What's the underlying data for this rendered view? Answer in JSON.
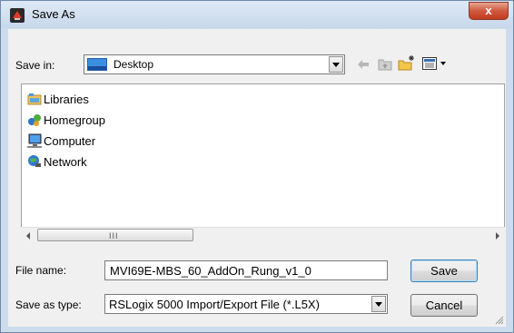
{
  "window": {
    "title": "Save As",
    "close_label": "x"
  },
  "toolbar": {
    "save_in_label": "Save in:",
    "save_in_value": "Desktop",
    "icons": [
      "back-arrow-icon",
      "up-folder-icon",
      "new-folder-icon",
      "view-menu-icon"
    ]
  },
  "file_list": {
    "items": [
      {
        "label": "Libraries",
        "icon": "libraries-icon"
      },
      {
        "label": "Homegroup",
        "icon": "homegroup-icon"
      },
      {
        "label": "Computer",
        "icon": "computer-icon"
      },
      {
        "label": "Network",
        "icon": "network-icon"
      }
    ],
    "scroll_grip": "III"
  },
  "form": {
    "file_name_label": "File name:",
    "file_name_value": "MVI69E-MBS_60_AddOn_Rung_v1_0",
    "save_as_type_label": "Save as type:",
    "save_as_type_value": "RSLogix 5000 Import/Export File (*.L5X)"
  },
  "buttons": {
    "save": "Save",
    "cancel": "Cancel"
  },
  "colors": {
    "close_button": "#c9462b",
    "titlebar": "#d3e1f0",
    "dialog_bg": "#f0f0f0"
  }
}
